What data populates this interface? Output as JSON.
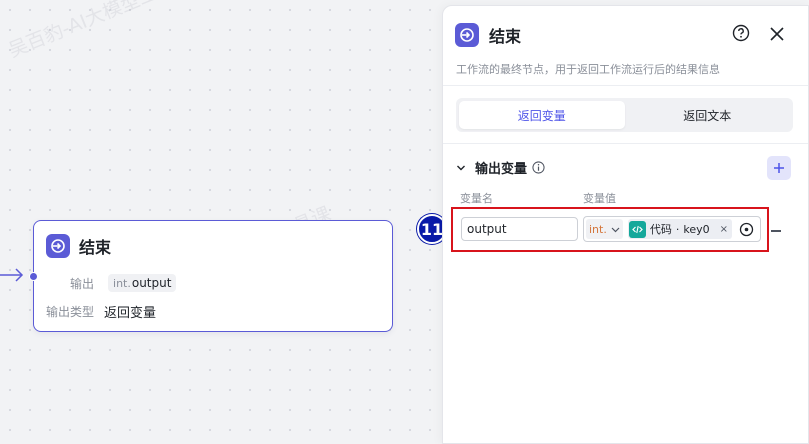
{
  "canvas": {
    "node": {
      "title": "结束",
      "output_label": "输出",
      "output_type": "int.",
      "output_name": "output",
      "output_kind_label": "输出类型",
      "output_kind_value": "返回变量"
    },
    "step_number": "11"
  },
  "panel": {
    "title": "结束",
    "description": "工作流的最终节点，用于返回工作流运行后的结果信息",
    "tabs": [
      {
        "label": "返回变量",
        "active": true
      },
      {
        "label": "返回文本",
        "active": false
      }
    ],
    "section_title": "输出变量",
    "col_name": "变量名",
    "col_value": "变量值",
    "row": {
      "name_value": "output",
      "type": "int.",
      "ref_source": "代码",
      "ref_sep": "·",
      "ref_key": "key0",
      "close_glyph": "×"
    }
  },
  "watermark": "吴百豹-AI大模型工具课",
  "colors": {
    "accent": "#5b5bd6",
    "tab_active": "#4d53e8",
    "highlight_box": "#d8141c",
    "step_badge": "#0a1aa8",
    "code_icon": "#14a89b"
  }
}
